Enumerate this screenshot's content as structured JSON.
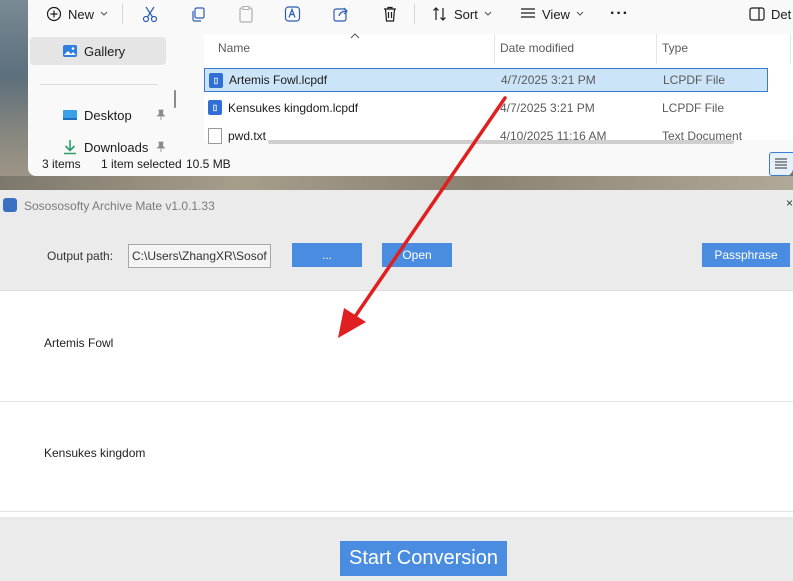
{
  "explorer": {
    "toolbar": {
      "new_label": "New",
      "sort_label": "Sort",
      "view_label": "View",
      "details_label": "Det"
    },
    "nav": {
      "gallery": "Gallery",
      "desktop": "Desktop",
      "downloads": "Downloads"
    },
    "columns": {
      "name": "Name",
      "date": "Date modified",
      "type": "Type"
    },
    "files": [
      {
        "name": "Artemis Fowl.lcpdf",
        "date": "4/7/2025 3:21 PM",
        "type": "LCPDF File",
        "selected": true
      },
      {
        "name": "Kensukes kingdom.lcpdf",
        "date": "4/7/2025 3:21 PM",
        "type": "LCPDF File",
        "selected": false
      },
      {
        "name": "pwd.txt",
        "date": "4/10/2025 11:16 AM",
        "type": "Text Document",
        "selected": false
      }
    ],
    "status": {
      "items": "3 items",
      "selected": "1 item selected",
      "size": "10.5 MB"
    }
  },
  "app": {
    "title": "Sosososofty Archive Mate v1.0.1.33",
    "output_label": "Output path:",
    "output_path": "C:\\Users\\ZhangXR\\Sosoft",
    "browse_label": "...",
    "open_label": "Open",
    "passphrase_label": "Passphrase",
    "books": [
      "Artemis Fowl",
      "Kensukes kingdom"
    ],
    "start_label": "Start Conversion"
  },
  "colors": {
    "accent": "#4a8de0",
    "selection": "#cce4f7",
    "arrow": "#e02020"
  }
}
